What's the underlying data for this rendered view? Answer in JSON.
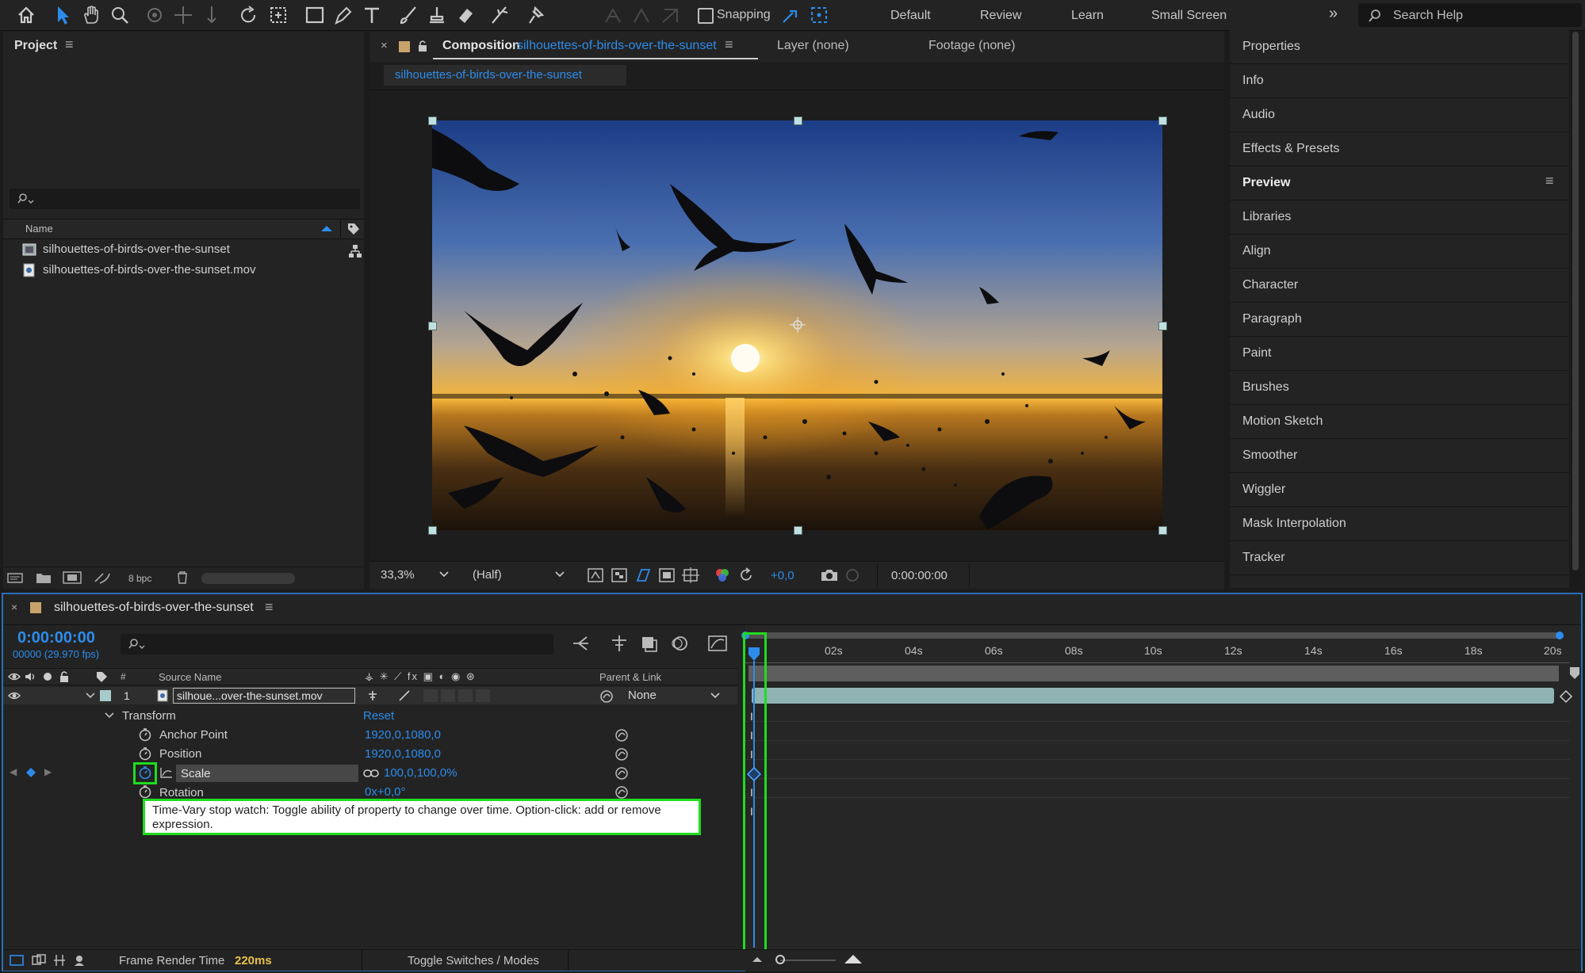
{
  "toolbar": {
    "snapping_label": "Snapping",
    "workspaces": [
      "Default",
      "Review",
      "Learn",
      "Small Screen"
    ],
    "search_placeholder": "Search Help"
  },
  "project": {
    "title": "Project",
    "column_name": "Name",
    "items": [
      {
        "name": "silhouettes-of-birds-over-the-sunset",
        "icon": "composition-icon"
      },
      {
        "name": "silhouettes-of-birds-over-the-sunset.mov",
        "icon": "footage-icon"
      }
    ],
    "bpc": "8 bpc"
  },
  "composition": {
    "tab_prefix": "Composition",
    "tab_name": "silhouettes-of-birds-over-the-sunset",
    "layer_tab": "Layer (none)",
    "footage_tab": "Footage (none)",
    "breadcrumb": "silhouettes-of-birds-over-the-sunset",
    "zoom": "33,3%",
    "resolution": "(Half)",
    "exposure": "+0,0",
    "timecode": "0:00:00:00"
  },
  "right_panel": {
    "items": [
      "Properties",
      "Info",
      "Audio",
      "Effects & Presets",
      "Preview",
      "Libraries",
      "Align",
      "Character",
      "Paragraph",
      "Paint",
      "Brushes",
      "Motion Sketch",
      "Smoother",
      "Wiggler",
      "Mask Interpolation",
      "Tracker"
    ]
  },
  "timeline": {
    "comp_name": "silhouettes-of-birds-over-the-sunset",
    "timecode": "0:00:00:00",
    "frame_info": "00000 (29.970 fps)",
    "col_number": "#",
    "col_source": "Source Name",
    "col_parent": "Parent & Link",
    "layer_index": "1",
    "layer_name": "silhoue...over-the-sunset.mov",
    "parent_value": "None",
    "transform_label": "Transform",
    "reset_label": "Reset",
    "props": [
      {
        "name": "Anchor Point",
        "value": "1920,0,1080,0"
      },
      {
        "name": "Position",
        "value": "1920,0,1080,0"
      },
      {
        "name": "Scale",
        "value": "100,0,100,0%"
      },
      {
        "name": "Rotation",
        "value": "0x+0,0°"
      }
    ],
    "tooltip": "Time-Vary stop watch: Toggle ability of property to change over time. Option-click: add or remove expression.",
    "ruler": [
      "02s",
      "04s",
      "06s",
      "08s",
      "10s",
      "12s",
      "14s",
      "16s",
      "18s",
      "20s"
    ],
    "frame_render_label": "Frame Render Time",
    "frame_render_value": "220ms",
    "toggle_label": "Toggle Switches / Modes"
  },
  "colors": {
    "accent": "#2d8ceb",
    "highlight_box": "#1fdc1f",
    "layer_bar": "#8fb3b3",
    "frame_render": "#e7c24a"
  }
}
